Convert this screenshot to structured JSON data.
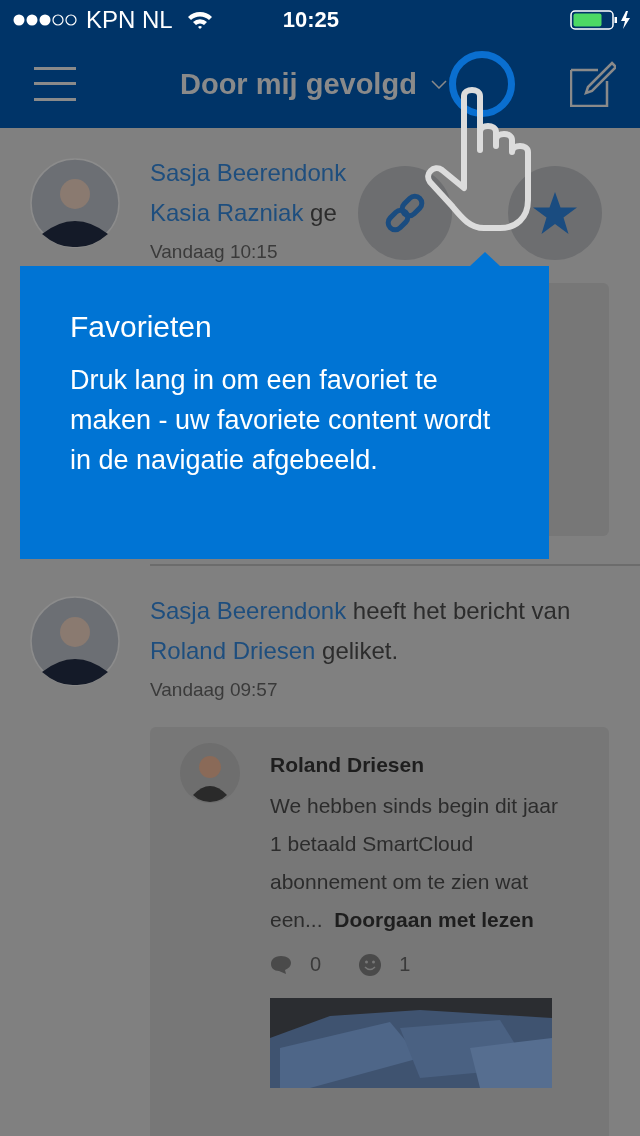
{
  "status_bar": {
    "carrier": "KPN NL",
    "time": "10:25"
  },
  "nav": {
    "title": "Door mij gevolgd"
  },
  "first_entry": {
    "actor": "Sasja Beerendonk",
    "target": "Kasia Razniak",
    "visible_text": "ge",
    "time": "Vandaag 10:15"
  },
  "second_entry": {
    "actor": "Sasja Beerendonk",
    "action": "heeft het bericht van",
    "target": "Roland Driesen",
    "suffix": "geliket.",
    "time": "Vandaag 09:57",
    "post": {
      "author": "Roland Driesen",
      "excerpt": "We hebben sinds begin dit jaar 1 betaald SmartCloud abonnement om te zien wat een...",
      "read_more": "Doorgaan met lezen",
      "comments": "0",
      "likes": "1"
    }
  },
  "tooltip": {
    "title": "Favorieten",
    "body": "Druk lang in om een favoriet te maken - uw favoriete content wordt in de navigatie afgebeeld."
  }
}
